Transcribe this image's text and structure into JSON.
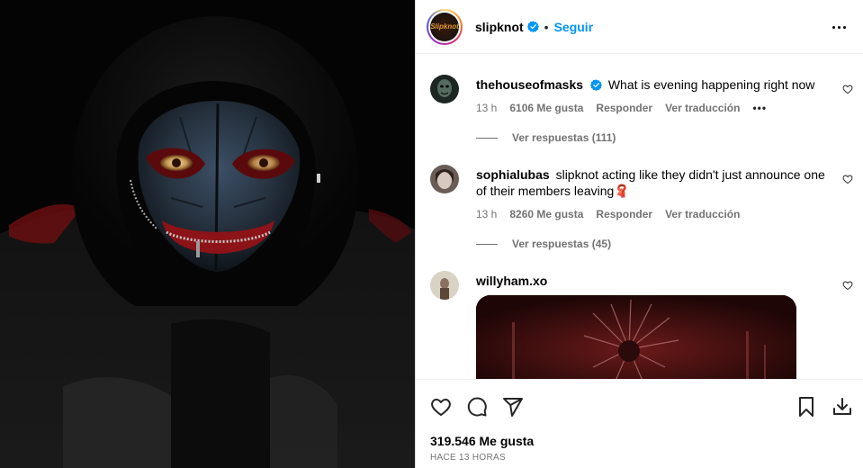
{
  "post": {
    "username": "slipknot",
    "avatar_text": "Slipknot",
    "follow_label": "Seguir",
    "likes": "319.546 Me gusta",
    "time_ago": "HACE 13 HORAS"
  },
  "comments": [
    {
      "username": "thehouseofmasks",
      "verified": true,
      "text": "What is evening happening right now",
      "time": "13 h",
      "likes": "6106 Me gusta",
      "reply_label": "Responder",
      "translate_label": "Ver traducción",
      "more": "•••",
      "view_replies": "Ver respuestas (111)"
    },
    {
      "username": "sophialubas",
      "verified": false,
      "text": "slipknot acting like they didn't just announce one of their members leaving🧣",
      "time": "13 h",
      "likes": "8260 Me gusta",
      "reply_label": "Responder",
      "translate_label": "Ver traducción",
      "view_replies": "Ver respuestas (45)"
    },
    {
      "username": "willyham.xo",
      "verified": false,
      "text": ""
    }
  ],
  "colors": {
    "accent": "#0095f6",
    "verified": "#0095f6",
    "muted": "#737373"
  },
  "icons": [
    "heart-icon",
    "comment-icon",
    "share-icon",
    "bookmark-icon",
    "download-icon",
    "more-icon",
    "verified-icon"
  ]
}
